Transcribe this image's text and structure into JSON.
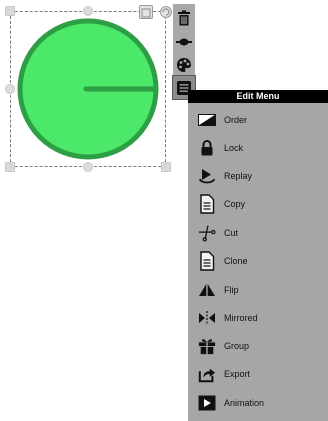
{
  "edit_menu": {
    "title": "Edit Menu",
    "items": [
      {
        "label": "Order",
        "icon": "order-icon"
      },
      {
        "label": "Lock",
        "icon": "lock-icon"
      },
      {
        "label": "Replay",
        "icon": "replay-icon"
      },
      {
        "label": "Copy",
        "icon": "copy-icon"
      },
      {
        "label": "Cut",
        "icon": "scissors-icon"
      },
      {
        "label": "Clone",
        "icon": "clone-icon"
      },
      {
        "label": "Flip",
        "icon": "flip-icon"
      },
      {
        "label": "Mirrored",
        "icon": "mirror-icon"
      },
      {
        "label": "Group",
        "icon": "group-icon"
      },
      {
        "label": "Export",
        "icon": "export-icon"
      },
      {
        "label": "Animation",
        "icon": "animation-icon"
      }
    ]
  },
  "tool_strip": {
    "items": [
      "trash-icon",
      "line-style-icon",
      "palette-icon",
      "menu-icon"
    ]
  },
  "shape": {
    "fill": "#4ce86a",
    "stroke": "#2e9e44"
  }
}
